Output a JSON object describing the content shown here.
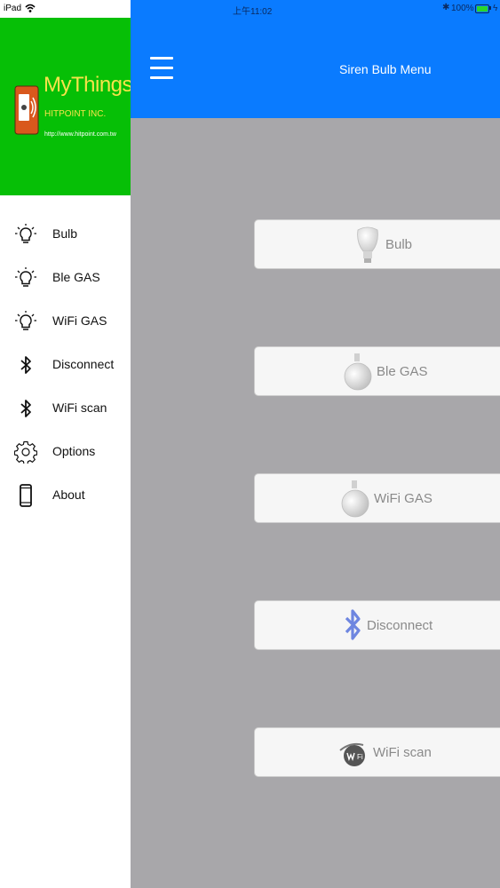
{
  "status_bar": {
    "device": "iPad",
    "time": "上午11:02",
    "battery": "100%"
  },
  "brand": {
    "title": "MyThings",
    "company": "HITPOINT INC.",
    "url": "http://www.hitpoint.com.tw",
    "title_color": "#f7e34a",
    "background": "#06bf06"
  },
  "sidebar": {
    "items": [
      {
        "label": "Bulb",
        "icon": "lightbulb-icon"
      },
      {
        "label": "Ble GAS",
        "icon": "lightbulb-icon"
      },
      {
        "label": "WiFi GAS",
        "icon": "lightbulb-icon"
      },
      {
        "label": "Disconnect",
        "icon": "bluetooth-icon"
      },
      {
        "label": "WiFi scan",
        "icon": "bluetooth-icon"
      },
      {
        "label": "Options",
        "icon": "gear-icon"
      },
      {
        "label": "About",
        "icon": "phone-icon"
      }
    ]
  },
  "header": {
    "title": "Siren Bulb Menu",
    "background": "#0a7bff"
  },
  "main": {
    "buttons": [
      {
        "label": "Bulb",
        "icon": "bulb-image-icon"
      },
      {
        "label": "Ble GAS",
        "icon": "gas-bulb-icon"
      },
      {
        "label": "WiFi GAS",
        "icon": "gas-bulb-icon"
      },
      {
        "label": "Disconnect",
        "icon": "bluetooth-icon"
      },
      {
        "label": "WiFi scan",
        "icon": "wifi-icon"
      }
    ],
    "background": "#a8a7aa"
  }
}
